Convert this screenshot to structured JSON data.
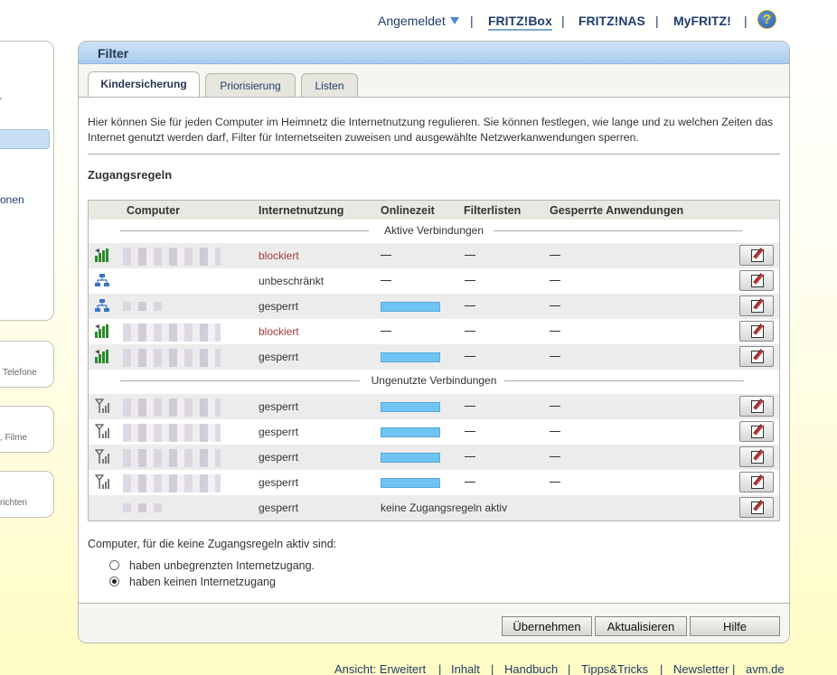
{
  "topnav": {
    "login_label": "Angemeldet",
    "links": [
      "FRITZ!Box",
      "FRITZ!NAS",
      "MyFRITZ!"
    ],
    "separator": "|",
    "help": "?"
  },
  "left": {
    "frag1": "r",
    "frag2": "onen",
    "frag3": "Telefone",
    "frag4": ", Filme",
    "frag5": "richten"
  },
  "panel": {
    "title": "Filter",
    "tabs": [
      "Kindersicherung",
      "Priorisierung",
      "Listen"
    ],
    "intro": "Hier können Sie für jeden Computer im Heimnetz die Internetnutzung regulieren. Sie können festlegen, wie lange und zu welchen Zeiten das Internet genutzt werden darf, Filter für Internetseiten zuweisen und ausgewählte Netzwerkanwendungen sperren.",
    "section_title": "Zugangsregeln"
  },
  "table": {
    "headers": [
      "Computer",
      "Internetnutzung",
      "Onlinezeit",
      "Filterlisten",
      "Gesperrte Anwendungen"
    ],
    "group_active": "Aktive Verbindungen",
    "group_unused": "Ungenutzte Verbindungen",
    "dash": "—",
    "active_rows": [
      {
        "icon": "wifi-signal-icon",
        "usage": "blockiert",
        "blocked": true,
        "online": "dash",
        "filter": "dash",
        "apps": "dash"
      },
      {
        "icon": "lan-network-icon",
        "usage": "unbeschränkt",
        "blocked": false,
        "online": "dash",
        "filter": "dash",
        "apps": "dash"
      },
      {
        "icon": "lan-network-icon",
        "usage": "gesperrt",
        "blocked": false,
        "online": "bar",
        "filter": "dash",
        "apps": "dash"
      },
      {
        "icon": "wifi-signal-icon",
        "usage": "blockiert",
        "blocked": true,
        "online": "dash",
        "filter": "dash",
        "apps": "dash"
      },
      {
        "icon": "wifi-signal-icon",
        "usage": "gesperrt",
        "blocked": false,
        "online": "bar",
        "filter": "dash",
        "apps": "dash"
      }
    ],
    "unused_rows": [
      {
        "icon": "wifi-offline-icon",
        "usage": "gesperrt",
        "online": "bar",
        "filter": "dash",
        "apps": "dash"
      },
      {
        "icon": "wifi-offline-icon",
        "usage": "gesperrt",
        "online": "bar",
        "filter": "dash",
        "apps": "dash"
      },
      {
        "icon": "wifi-offline-icon",
        "usage": "gesperrt",
        "online": "bar",
        "filter": "dash",
        "apps": "dash"
      },
      {
        "icon": "wifi-offline-icon",
        "usage": "gesperrt",
        "online": "bar",
        "filter": "dash",
        "apps": "dash"
      }
    ],
    "default_row": {
      "usage": "gesperrt",
      "note": "keine Zugangsregeln aktiv"
    }
  },
  "radios": {
    "intro": "Computer, für die keine Zugangsregeln aktiv sind:",
    "options": [
      {
        "label": "haben unbegrenzten Internetzugang.",
        "checked": false
      },
      {
        "label": "haben keinen Internetzugang",
        "checked": true
      }
    ]
  },
  "buttons": {
    "apply": "Übernehmen",
    "refresh": "Aktualisieren",
    "help": "Hilfe"
  },
  "footer": {
    "items": [
      "Ansicht: Erweitert",
      "Inhalt",
      "Handbuch",
      "Tipps&Tricks",
      "Newsletter",
      "avm.de"
    ],
    "separator": "|"
  },
  "colors": {
    "accent": "#70c4f4",
    "blocked_text": "#a33a3a",
    "header_blue": "#a9cbee",
    "link": "#1f3d6b"
  }
}
